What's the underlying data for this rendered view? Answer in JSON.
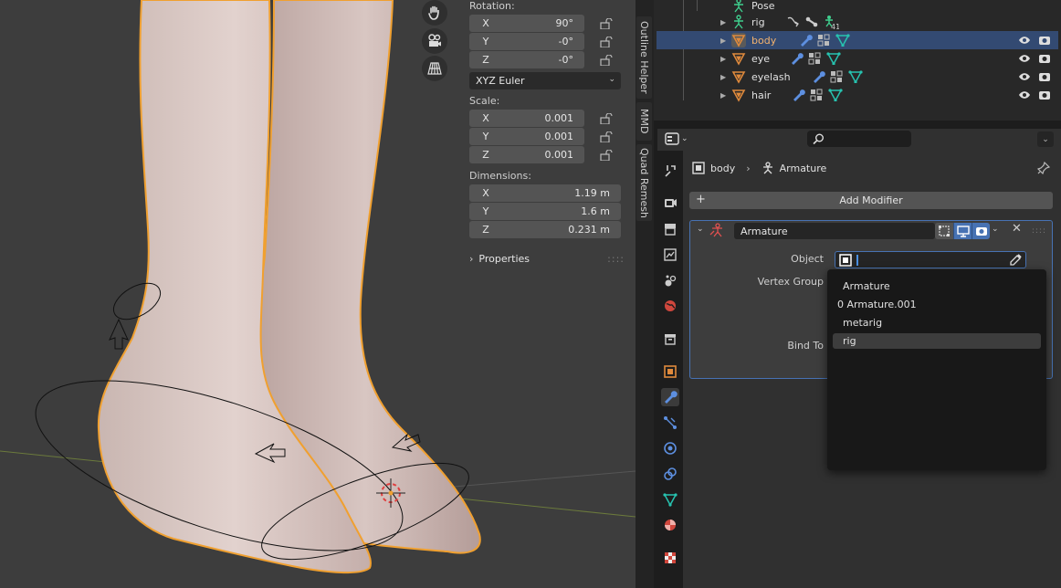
{
  "npanel": {
    "rotation_label": "Rotation:",
    "rotation": [
      {
        "axis": "X",
        "value": "90°"
      },
      {
        "axis": "Y",
        "value": "-0°"
      },
      {
        "axis": "Z",
        "value": "-0°"
      }
    ],
    "rotation_mode": "XYZ Euler",
    "scale_label": "Scale:",
    "scale": [
      {
        "axis": "X",
        "value": "0.001"
      },
      {
        "axis": "Y",
        "value": "0.001"
      },
      {
        "axis": "Z",
        "value": "0.001"
      }
    ],
    "dimensions_label": "Dimensions:",
    "dimensions": [
      {
        "axis": "X",
        "value": "1.19 m"
      },
      {
        "axis": "Y",
        "value": "1.6 m"
      },
      {
        "axis": "Z",
        "value": "0.231 m"
      }
    ],
    "properties_label": "Properties"
  },
  "side_tabs": [
    "Outline Helper",
    "MMD",
    "Quad Remesh"
  ],
  "outliner": {
    "rows": [
      {
        "name": "Pose",
        "type": "pose"
      },
      {
        "name": "rig",
        "type": "armature",
        "badge": "414"
      },
      {
        "name": "body",
        "type": "mesh",
        "selected": true
      },
      {
        "name": "eye",
        "type": "mesh"
      },
      {
        "name": "eyelash",
        "type": "mesh"
      },
      {
        "name": "hair",
        "type": "mesh"
      }
    ]
  },
  "properties": {
    "breadcrumb": {
      "object": "body",
      "modifier": "Armature"
    },
    "add_modifier": "Add Modifier",
    "modifier": {
      "name": "Armature",
      "object_label": "Object",
      "vertex_group_label": "Vertex Group",
      "bind_to_label": "Bind To"
    },
    "dropdown": {
      "items": [
        "Armature",
        "0 Armature.001",
        "metarig",
        "rig"
      ],
      "highlighted": "rig"
    }
  },
  "colors": {
    "selection": "#334a72",
    "accent_blue": "#4772b3",
    "outline_orange": "#f0a030",
    "armature_green": "#3fcf8e",
    "mesh_orange": "#e08a3c"
  }
}
